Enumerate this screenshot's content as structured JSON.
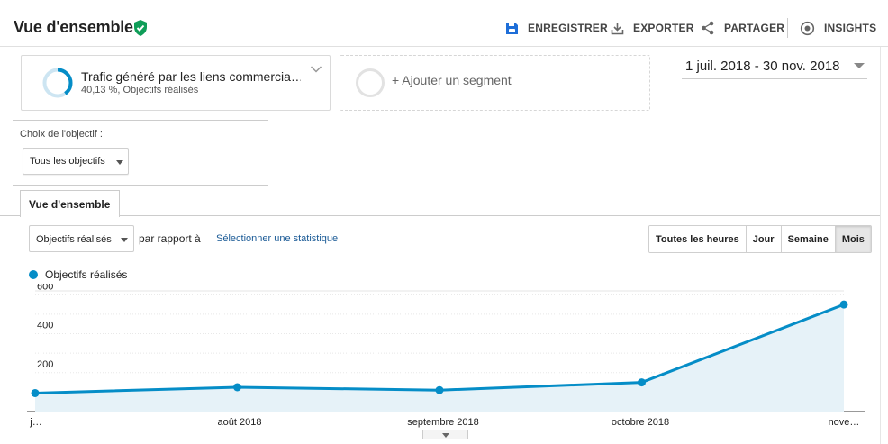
{
  "header": {
    "title": "Vue d'ensemble",
    "actions": {
      "save": "ENREGISTRER",
      "export": "EXPORTER",
      "share": "PARTAGER",
      "insights": "INSIGHTS"
    }
  },
  "segment": {
    "name": "Trafic généré par les liens commercia…",
    "stat": "40,13 %, Objectifs réalisés",
    "percent": 40.13,
    "add_label": "+ Ajouter un segment"
  },
  "date_range": "1 juil. 2018 - 30 nov. 2018",
  "objective": {
    "label": "Choix de l'objectif :",
    "selected": "Tous les objectifs"
  },
  "tab": "Vue d'ensemble",
  "controls": {
    "metric": "Objectifs réalisés",
    "compare": "par rapport à",
    "select_stat": "Sélectionner une statistique",
    "granularity": [
      "Toutes les heures",
      "Jour",
      "Semaine",
      "Mois"
    ],
    "active_granularity": "Mois"
  },
  "colors": {
    "accent": "#058dc7",
    "verified": "#0f9d58",
    "link": "#1a5a96"
  },
  "chart_data": {
    "type": "area",
    "series": [
      {
        "name": "Objectifs réalisés",
        "values": [
          95,
          125,
          110,
          150,
          550
        ]
      }
    ],
    "x_labels": [
      "j…",
      "août 2018",
      "septembre 2018",
      "octobre 2018",
      "nove…"
    ],
    "y_ticks": [
      200,
      400,
      600
    ],
    "ylim": [
      0,
      620
    ],
    "grid": true,
    "legend_position": "top-left"
  }
}
